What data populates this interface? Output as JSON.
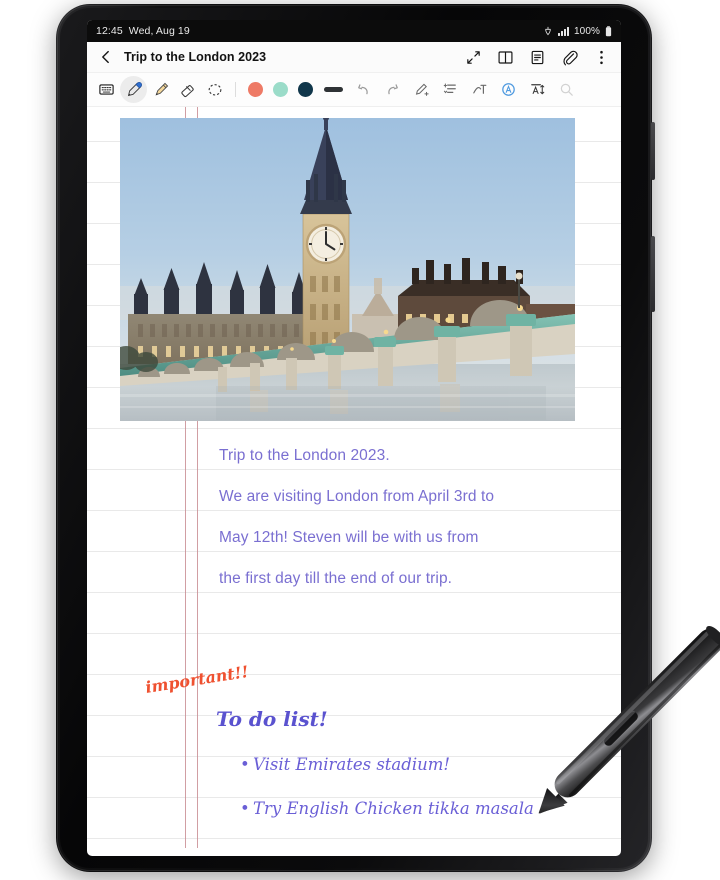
{
  "status_bar": {
    "time": "12:45",
    "date": "Wed, Aug 19",
    "battery_percent": "100%",
    "icons": [
      "nfc-icon",
      "signal-bars-icon",
      "battery-icon"
    ]
  },
  "app_header": {
    "back_icon": "chevron-left-icon",
    "title": "Trip to the London 2023",
    "actions": [
      {
        "name": "expand-icon",
        "label": "Expand"
      },
      {
        "name": "book-view-icon",
        "label": "Book view"
      },
      {
        "name": "note-view-icon",
        "label": "Note view"
      },
      {
        "name": "attachment-icon",
        "label": "Attach"
      },
      {
        "name": "more-options-icon",
        "label": "More options"
      }
    ]
  },
  "pen_toolbar": {
    "tools": [
      {
        "name": "keyboard-text-icon",
        "label": "Text mode",
        "selected": false
      },
      {
        "name": "pen-icon",
        "label": "Pen",
        "selected": true
      },
      {
        "name": "highlighter-icon",
        "label": "Highlighter",
        "selected": false
      },
      {
        "name": "eraser-icon",
        "label": "Eraser",
        "selected": false
      },
      {
        "name": "lasso-select-icon",
        "label": "Selection",
        "selected": false
      }
    ],
    "colors": [
      {
        "name": "color-swatch-coral",
        "hex": "#EE7A66"
      },
      {
        "name": "color-swatch-mint",
        "hex": "#9BDCC9"
      },
      {
        "name": "color-swatch-navy",
        "hex": "#11374B"
      }
    ],
    "stroke_color": "#2F3336",
    "right_tools": [
      {
        "name": "undo-icon",
        "label": "Undo"
      },
      {
        "name": "redo-icon",
        "label": "Redo"
      },
      {
        "name": "straighten-handwriting-icon",
        "label": "Straighten"
      },
      {
        "name": "align-text-icon",
        "label": "Align"
      },
      {
        "name": "convert-to-text-icon",
        "label": "Convert to text"
      },
      {
        "name": "auto-format-icon",
        "label": "Auto format"
      },
      {
        "name": "text-size-icon",
        "label": "Text size"
      },
      {
        "name": "zoom-icon",
        "label": "Zoom"
      }
    ]
  },
  "note": {
    "image_caption": "big-ben-westminster-bridge-photo",
    "typed_lines": [
      "Trip to the London 2023.",
      "We are visiting London from April 3rd to",
      "May 12th! Steven will be with us from",
      "the first day till the end of our trip."
    ],
    "typed_color": "#7A6FD1",
    "annotation": "important!!",
    "annotation_color": "#EF5130",
    "handwritten_heading": "To do list!",
    "heading_color": "#5A52CF",
    "todo_items": [
      "Visit Emirates stadium!",
      "Try English Chicken tikka masala"
    ],
    "todo_color": "#6A5FD6",
    "margin_line_color": "#C98D93",
    "rule_line_color": "#E9E9E9"
  },
  "device": {
    "stylus": "s-pen-stylus",
    "body_color": "#0A0A0B"
  }
}
